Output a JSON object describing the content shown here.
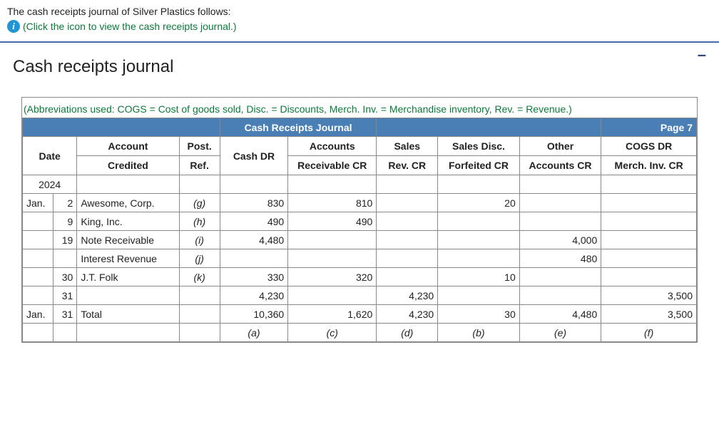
{
  "intro": "The cash receipts journal of Silver Plastics follows:",
  "info_link": "(Click the icon to view the cash receipts journal.)",
  "title": "Cash receipts journal",
  "abbrev": "(Abbreviations used: COGS = Cost of goods sold, Disc. = Discounts, Merch. Inv. = Merchandise inventory, Rev. = Revenue.)",
  "bluebar_title": "Cash Receipts Journal",
  "bluebar_page": "Page 7",
  "headers": {
    "date": "Date",
    "account1": "Account",
    "account2": "Credited",
    "post1": "Post.",
    "post2": "Ref.",
    "cash": "Cash DR",
    "ar1": "Accounts",
    "ar2": "Receivable CR",
    "sales1": "Sales",
    "sales2": "Rev. CR",
    "disc1": "Sales Disc.",
    "disc2": "Forfeited CR",
    "other1": "Other",
    "other2": "Accounts CR",
    "cogs1": "COGS DR",
    "cogs2": "Merch. Inv. CR"
  },
  "year": "2024",
  "rows": [
    {
      "m": "Jan.",
      "d": "2",
      "acct": "Awesome, Corp.",
      "ref": "(g)",
      "cash": "830",
      "ar": "810",
      "sales": "",
      "disc": "20",
      "other": "",
      "cogs": ""
    },
    {
      "m": "",
      "d": "9",
      "acct": "King, Inc.",
      "ref": "(h)",
      "cash": "490",
      "ar": "490",
      "sales": "",
      "disc": "",
      "other": "",
      "cogs": ""
    },
    {
      "m": "",
      "d": "19",
      "acct": "Note Receivable",
      "ref": "(i)",
      "cash": "4,480",
      "ar": "",
      "sales": "",
      "disc": "",
      "other": "4,000",
      "cogs": ""
    },
    {
      "m": "",
      "d": "",
      "acct": "Interest Revenue",
      "ref": "(j)",
      "cash": "",
      "ar": "",
      "sales": "",
      "disc": "",
      "other": "480",
      "cogs": ""
    },
    {
      "m": "",
      "d": "30",
      "acct": "J.T. Folk",
      "ref": "(k)",
      "cash": "330",
      "ar": "320",
      "sales": "",
      "disc": "10",
      "other": "",
      "cogs": ""
    },
    {
      "m": "",
      "d": "31",
      "acct": "",
      "ref": "",
      "cash": "4,230",
      "ar": "",
      "sales": "4,230",
      "disc": "",
      "other": "",
      "cogs": "3,500"
    }
  ],
  "total": {
    "m": "Jan.",
    "d": "31",
    "acct": "Total",
    "ref": "",
    "cash": "10,360",
    "ar": "1,620",
    "sales": "4,230",
    "disc": "30",
    "other": "4,480",
    "cogs": "3,500"
  },
  "footnotes": {
    "cash": "(a)",
    "ar": "(c)",
    "sales": "(d)",
    "disc": "(b)",
    "other": "(e)",
    "cogs": "(f)"
  },
  "minus": "–"
}
